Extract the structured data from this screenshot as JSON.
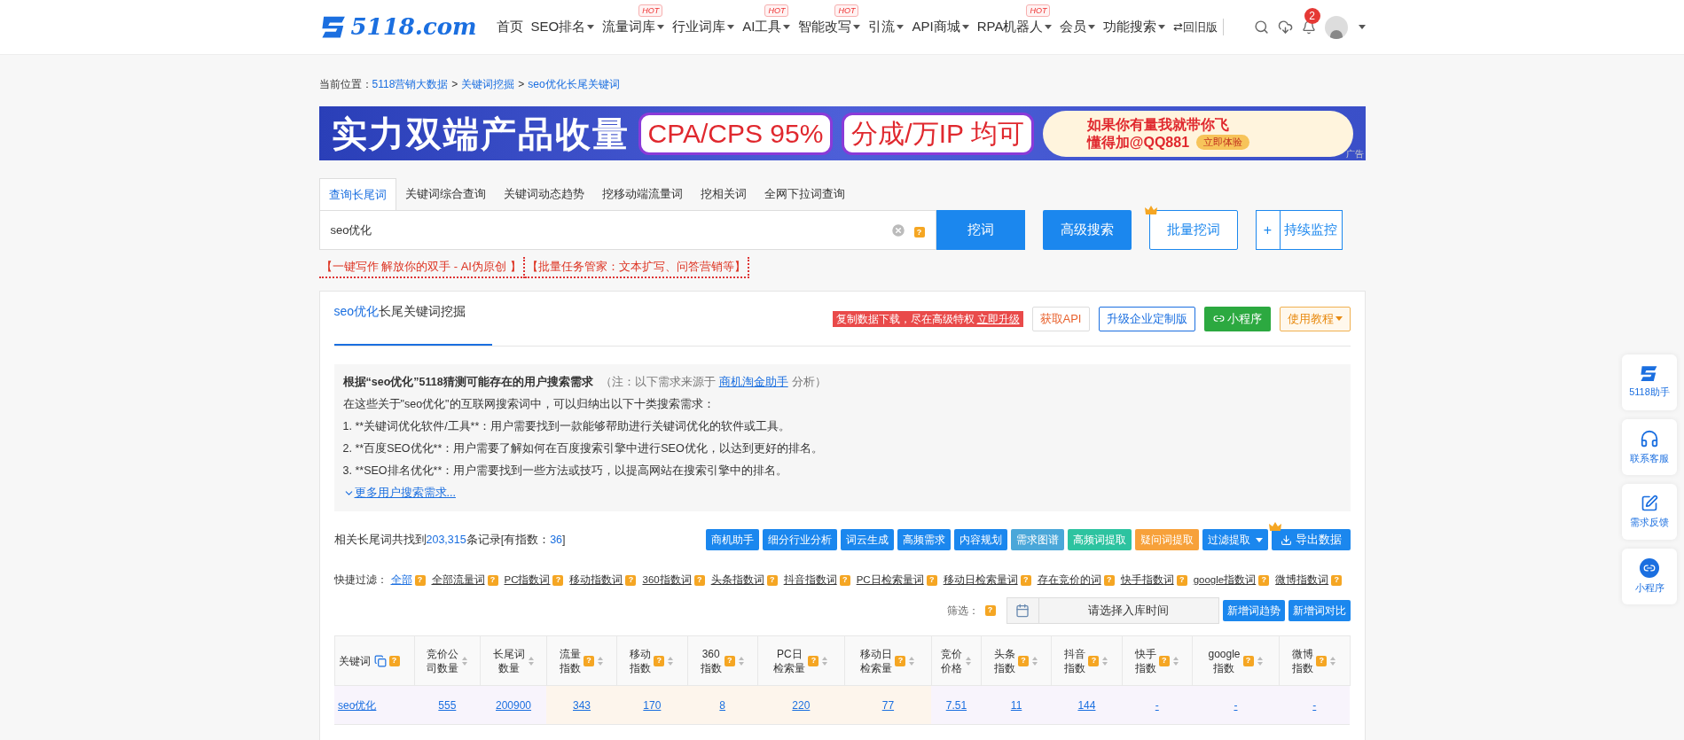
{
  "nav": {
    "logo": "5118.com",
    "items": [
      {
        "label": "首页",
        "dropdown": false
      },
      {
        "label": "SEO排名",
        "dropdown": true
      },
      {
        "label": "流量词库",
        "dropdown": true,
        "badge": "HOT"
      },
      {
        "label": "行业词库",
        "dropdown": true
      },
      {
        "label": "AI工具",
        "dropdown": true,
        "badge": "HOT"
      },
      {
        "label": "智能改写",
        "dropdown": true,
        "badge": "HOT"
      },
      {
        "label": "引流",
        "dropdown": true
      },
      {
        "label": "API商城",
        "dropdown": true
      },
      {
        "label": "RPA机器人",
        "dropdown": true,
        "badge": "HOT"
      },
      {
        "label": "会员",
        "dropdown": true
      },
      {
        "label": "功能搜索",
        "dropdown": true
      }
    ],
    "old_version": "⇄回旧版",
    "notification_count": "2"
  },
  "breadcrumb": {
    "prefix": "当前位置：",
    "links": [
      "5118营销大数据",
      "关键词挖掘",
      "seo优化长尾关键词"
    ],
    "separator": ">"
  },
  "banner": {
    "headline": "实力双端产品收量",
    "pill_1": "CPA/CPS 95%",
    "pill_2": "分成/万IP 均可",
    "promo_line_1": "如果你有量我就带你飞",
    "promo_line_2": "懂得加@QQ881",
    "promo_button": "立即体验",
    "ad_mark": "广告"
  },
  "tabs": [
    {
      "label": "查询长尾词",
      "selected": true
    },
    {
      "label": "关键词综合查询",
      "selected": false
    },
    {
      "label": "关键词动态趋势",
      "selected": false
    },
    {
      "label": "挖移动端流量词",
      "selected": false
    },
    {
      "label": "挖相关词",
      "selected": false
    },
    {
      "label": "全网下拉词查询",
      "selected": false
    }
  ],
  "search": {
    "value": "seo优化",
    "submit": "挖词",
    "advanced": "高级搜索",
    "batch": "批量挖词",
    "plus": "+",
    "monitor": "持续监控"
  },
  "promos": [
    "【一键写作 解放你的双手 - AI伪原创 】",
    "【批量任务管家：文本扩写、问答营销等】"
  ],
  "card": {
    "title_keyword": "seo优化",
    "title_rest": "长尾关键词挖掘",
    "upgrade_notice": "复制数据下载，尽在高级特权",
    "upgrade_link": "立即升级",
    "api": "获取API",
    "enterprise": "升级企业定制版",
    "mini_program": "小程序",
    "tutorial": "使用教程"
  },
  "demand": {
    "heading": "根据“seo优化”5118猜测可能存在的用户搜索需求",
    "note_prefix": "（注：以下需求来源于",
    "note_link": "商机淘金助手",
    "note_suffix": "分析）",
    "intro": "在这些关于\"seo优化\"的互联网搜索词中，可以归纳出以下十类搜索需求：",
    "lines": [
      "1. **关键词优化软件/工具**：用户需要找到一款能够帮助进行关键词优化的软件或工具。",
      "2. **百度SEO优化**：用户需要了解如何在百度搜索引擎中进行SEO优化，以达到更好的排名。",
      "3. **SEO排名优化**：用户需要找到一些方法或技巧，以提高网站在搜索引擎中的排名。"
    ],
    "more": "更多用户搜索需求..."
  },
  "summary": {
    "prefix": "相关长尾词共找到",
    "count": "203,315",
    "middle": "条记录[有指数：",
    "indexed": "36",
    "suffix": "]"
  },
  "tools": [
    {
      "label": "商机助手",
      "color": "#1b87ee",
      "kind": "plain"
    },
    {
      "label": "细分行业分析",
      "color": "#1b87ee",
      "kind": "plain"
    },
    {
      "label": "词云生成",
      "color": "#1b87ee",
      "kind": "plain"
    },
    {
      "label": "高频需求",
      "color": "#1b87ee",
      "kind": "plain"
    },
    {
      "label": "内容规划",
      "color": "#1b87ee",
      "kind": "plain"
    },
    {
      "label": "需求图谱",
      "color": "#4aa7d9",
      "kind": "plain"
    },
    {
      "label": "高频词提取",
      "color": "#2dc3a0",
      "kind": "plain"
    },
    {
      "label": "疑问词提取",
      "color": "#f7a13a",
      "kind": "plain"
    },
    {
      "label": "过滤提取",
      "color": "#1b87ee",
      "kind": "dropdown"
    },
    {
      "label": "导出数据",
      "color": "#1b87ee",
      "kind": "download"
    }
  ],
  "quick_filter": {
    "label": "快捷过滤：",
    "items": [
      {
        "label": "全部",
        "selected": true
      },
      {
        "label": "全部流量词",
        "selected": false
      },
      {
        "label": "PC指数词",
        "selected": false
      },
      {
        "label": "移动指数词",
        "selected": false
      },
      {
        "label": "360指数词",
        "selected": false
      },
      {
        "label": "头条指数词",
        "selected": false
      },
      {
        "label": "抖音指数词",
        "selected": false
      },
      {
        "label": "PC日检索量词",
        "selected": false
      },
      {
        "label": "移动日检索量词",
        "selected": false
      },
      {
        "label": "存在竞价的词",
        "selected": false
      },
      {
        "label": "快手指数词",
        "selected": false
      },
      {
        "label": "google指数词",
        "selected": false
      },
      {
        "label": "微博指数词",
        "selected": false
      }
    ]
  },
  "help_mark": "?",
  "date_filter": {
    "label": "筛选：",
    "placeholder": "请选择入库时间",
    "trend": "新增词趋势",
    "compare": "新增词对比"
  },
  "table": {
    "columns": [
      {
        "lines": [
          "关键词"
        ],
        "help": true,
        "sortable": false,
        "kind": "basic"
      },
      {
        "lines": [
          "竞价公",
          "司数量"
        ],
        "help": false,
        "sortable": true,
        "kind": "basic"
      },
      {
        "lines": [
          "长尾词",
          "数量"
        ],
        "help": false,
        "sortable": true,
        "kind": "basic"
      },
      {
        "lines": [
          "流量",
          "指数"
        ],
        "help": true,
        "sortable": true,
        "kind": "traffic"
      },
      {
        "lines": [
          "移动",
          "指数"
        ],
        "help": true,
        "sortable": true,
        "kind": "traffic"
      },
      {
        "lines": [
          "360",
          "指数"
        ],
        "help": true,
        "sortable": true,
        "kind": "traffic"
      },
      {
        "lines": [
          "PC日",
          "检索量"
        ],
        "help": true,
        "sortable": true,
        "kind": "traffic"
      },
      {
        "lines": [
          "移动日",
          "检索量"
        ],
        "help": true,
        "sortable": true,
        "kind": "traffic"
      },
      {
        "lines": [
          "竞价",
          "价格"
        ],
        "help": false,
        "sortable": true,
        "kind": "basic"
      },
      {
        "lines": [
          "头条",
          "指数"
        ],
        "help": true,
        "sortable": true,
        "kind": "basic"
      },
      {
        "lines": [
          "抖音",
          "指数"
        ],
        "help": true,
        "sortable": true,
        "kind": "basic"
      },
      {
        "lines": [
          "快手",
          "指数"
        ],
        "help": true,
        "sortable": true,
        "kind": "basic"
      },
      {
        "lines": [
          "google",
          "指数"
        ],
        "help": true,
        "sortable": true,
        "kind": "basic"
      },
      {
        "lines": [
          "微博",
          "指数"
        ],
        "help": true,
        "sortable": true,
        "kind": "basic"
      }
    ],
    "rows": [
      [
        "seo优化",
        "555",
        "200900",
        "343",
        "170",
        "8",
        "220",
        "77",
        "7.51",
        "11",
        "144",
        "-",
        "-",
        "-"
      ]
    ]
  },
  "side_tools": [
    {
      "label": "5118助手",
      "kind": "logo"
    },
    {
      "label": "联系客服",
      "kind": "headset"
    },
    {
      "label": "需求反馈",
      "kind": "edit"
    },
    {
      "label": "小程序",
      "kind": "mini"
    }
  ]
}
